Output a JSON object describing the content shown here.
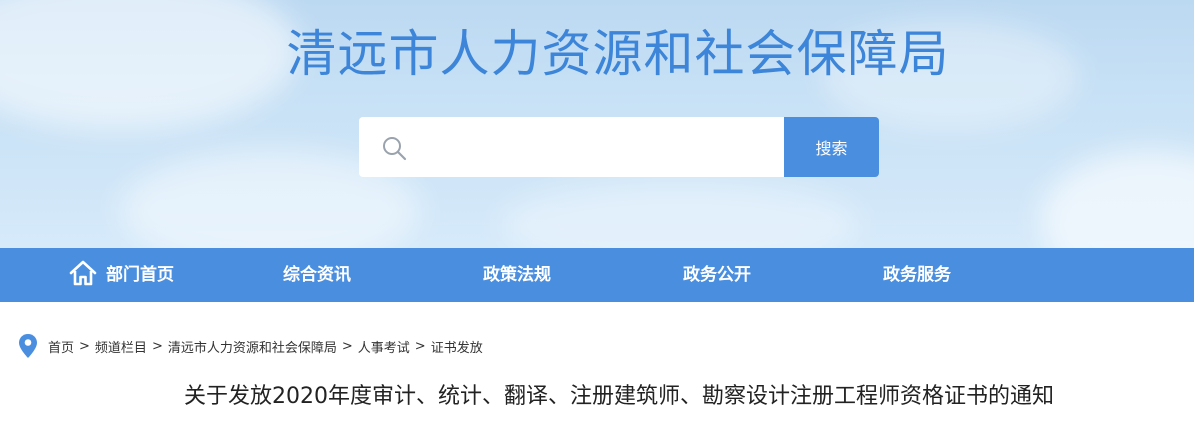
{
  "header": {
    "site_title": "清远市人力资源和社会保障局"
  },
  "search": {
    "placeholder": "",
    "value": "",
    "button_label": "搜索",
    "icon": "search-icon"
  },
  "nav": {
    "items": [
      {
        "label": "部门首页",
        "icon": "home-icon"
      },
      {
        "label": "综合资讯"
      },
      {
        "label": "政策法规"
      },
      {
        "label": "政务公开"
      },
      {
        "label": "政务服务"
      }
    ]
  },
  "breadcrumb": {
    "icon": "location-pin-icon",
    "items": [
      "首页",
      "频道栏目",
      "清远市人力资源和社会保障局",
      "人事考试",
      "证书发放"
    ],
    "separator": ">"
  },
  "article": {
    "title": "关于发放2020年度审计、统计、翻译、注册建筑师、勘察设计注册工程师资格证书的通知"
  },
  "colors": {
    "accent": "#4a8ee0",
    "title_blue": "#3d85d8",
    "header_bg": "#c9e2f6"
  }
}
